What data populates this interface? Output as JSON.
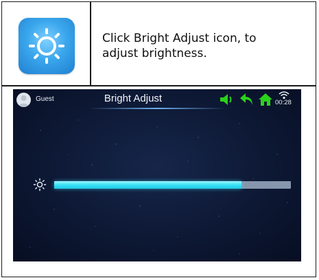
{
  "instruction_text": "Click Bright Adjust icon, to adjust brightness.",
  "instruction_lines": [
    "Click Bright Adjust icon, to",
    "adjust brightness."
  ],
  "device": {
    "user_label": "Guest",
    "title": "Bright Adjust",
    "clock": "00:28",
    "brightness_level": 0.79
  },
  "icons": {
    "app_icon": "sun-icon",
    "user": "avatar-icon",
    "volume": "speaker-icon",
    "back": "back-arrow-icon",
    "home": "home-icon",
    "wifi": "wifi-icon",
    "brightness": "sun-icon"
  },
  "colors": {
    "icon_blue": "#2f95e3",
    "slider_fill": "#3fe4f7",
    "slider_track": "#8596ad",
    "status_green": "#2bd11b",
    "screen_bg": "#0d1834"
  }
}
